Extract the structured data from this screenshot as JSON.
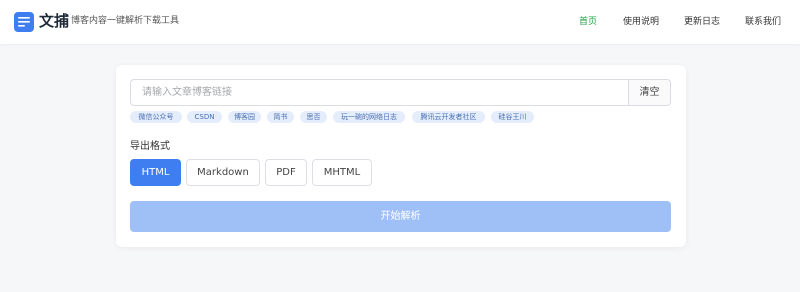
{
  "header": {
    "brand": "文捕",
    "tagline": "博客内容一键解析下载工具",
    "nav": [
      "首页",
      "使用说明",
      "更新日志",
      "联系我们"
    ],
    "active_nav": "首页"
  },
  "search": {
    "placeholder": "请输入文章博客链接",
    "value": "",
    "clear_label": "清空"
  },
  "sources": [
    "微信公众号",
    "CSDN",
    "博客园",
    "简书",
    "思否",
    "玩一碗的网络日志",
    "腾讯云开发者社区",
    "硅谷王川"
  ],
  "export": {
    "label": "导出格式",
    "formats": [
      "HTML",
      "Markdown",
      "PDF",
      "MHTML"
    ],
    "selected": "HTML"
  },
  "start_label": "开始解析",
  "colors": {
    "accent": "#3f7ef0",
    "active_nav": "#22a045",
    "start_button_disabled": "#9fc0f7",
    "tag_bg": "#e4edfc"
  },
  "icons": {
    "logo": "document-lines-icon"
  }
}
